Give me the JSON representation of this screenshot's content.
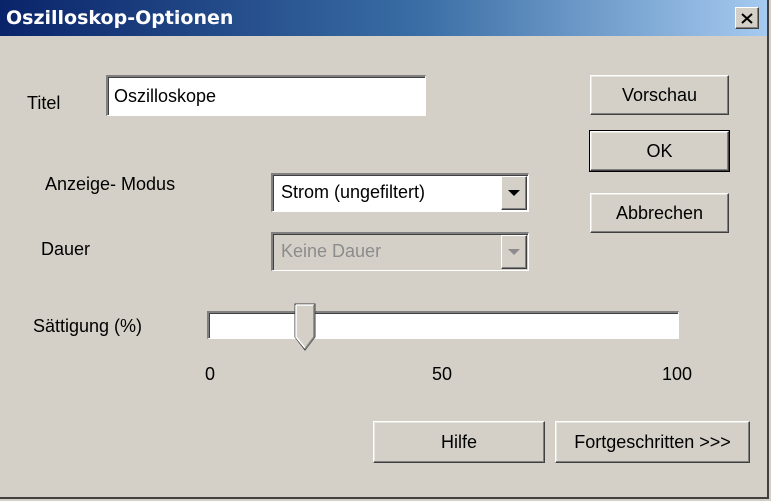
{
  "window": {
    "title": "Oszilloskop-Optionen",
    "close_glyph": "✕"
  },
  "form": {
    "title_label": "Titel",
    "title_value": "Oszilloskope",
    "mode_label": "Anzeige- Modus",
    "mode_value": "Strom (ungefiltert)",
    "duration_label": "Dauer",
    "duration_value": "Keine Dauer",
    "saturation_label": "Sättigung (%)",
    "saturation_value": 20,
    "slider_ticks": [
      "0",
      "50",
      "100"
    ]
  },
  "buttons": {
    "preview": "Vorschau",
    "ok": "OK",
    "cancel": "Abbrechen",
    "help": "Hilfe",
    "advanced": "Fortgeschritten >>>"
  },
  "colors": {
    "face": "#d4d0c8",
    "title_start": "#0a246a",
    "title_end": "#a6caf0"
  }
}
